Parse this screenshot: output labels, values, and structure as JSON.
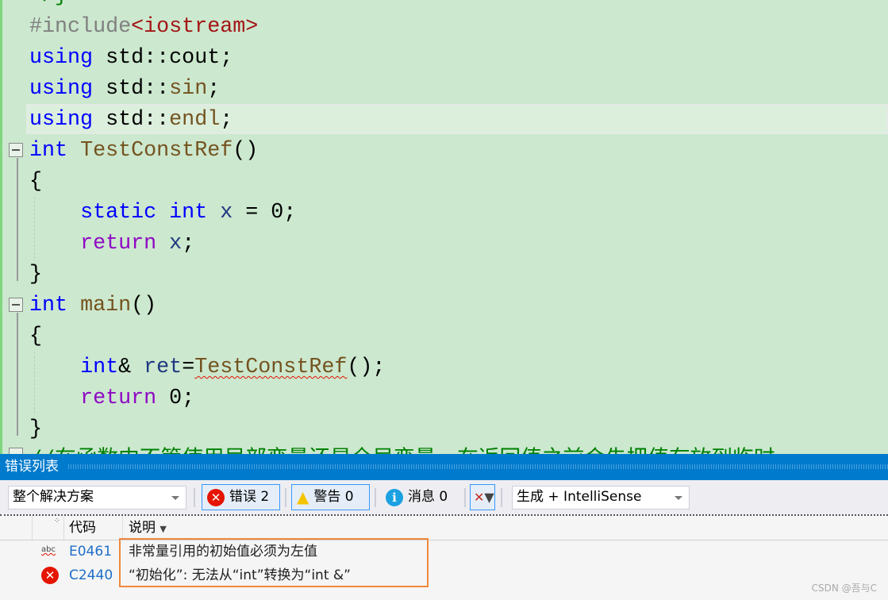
{
  "editor": {
    "lines": [
      [
        [
          "*/}",
          "cm"
        ]
      ],
      [
        [
          "#include",
          "pp"
        ],
        [
          "<iostream>",
          "inc"
        ]
      ],
      [
        [
          "using",
          "kw"
        ],
        [
          " std::cout;",
          ""
        ]
      ],
      [
        [
          "using",
          "kw"
        ],
        [
          " std::",
          ""
        ],
        [
          "sin",
          "fn"
        ],
        [
          ";",
          ""
        ]
      ],
      [
        [
          "using",
          "kw"
        ],
        [
          " std::",
          ""
        ],
        [
          "endl",
          "fn"
        ],
        [
          ";",
          ""
        ]
      ],
      [
        [
          "int",
          "kw"
        ],
        [
          " ",
          ""
        ],
        [
          "TestConstRef",
          "fn"
        ],
        [
          "()",
          ""
        ]
      ],
      [
        [
          "{",
          ""
        ]
      ],
      [
        [
          "    ",
          ""
        ],
        [
          "static",
          "kw"
        ],
        [
          " ",
          ""
        ],
        [
          "int",
          "kw"
        ],
        [
          " ",
          ""
        ],
        [
          "x",
          "var"
        ],
        [
          " = 0;",
          ""
        ]
      ],
      [
        [
          "    ",
          ""
        ],
        [
          "return",
          "ret"
        ],
        [
          " ",
          ""
        ],
        [
          "x",
          "var"
        ],
        [
          ";",
          ""
        ]
      ],
      [
        [
          "}",
          ""
        ]
      ],
      [
        [
          "int",
          "kw"
        ],
        [
          " ",
          ""
        ],
        [
          "main",
          "fn"
        ],
        [
          "()",
          ""
        ]
      ],
      [
        [
          "{",
          ""
        ]
      ],
      [
        [
          "    ",
          ""
        ],
        [
          "int",
          "kw"
        ],
        [
          "& ",
          ""
        ],
        [
          "ret",
          "var"
        ],
        [
          "=",
          ""
        ],
        [
          "TestConstRef",
          "fn squig"
        ],
        [
          "();",
          ""
        ]
      ],
      [
        [
          "    ",
          ""
        ],
        [
          "return",
          "ret"
        ],
        [
          " 0;",
          ""
        ]
      ],
      [
        [
          "}",
          ""
        ]
      ],
      [
        [
          "//在函数中不管使用局部变量还是全局变量，在返回值之前会先把值存放到临时",
          "cm"
        ]
      ]
    ]
  },
  "panel": {
    "title": "错误列表",
    "scope": "整个解决方案",
    "errors": "错误 2",
    "warnings": "警告 0",
    "messages": "消息 0",
    "source": "生成 + IntelliSense",
    "col_code": "代码",
    "col_desc": "说明",
    "rows": [
      {
        "icon": "intellisense-squiggle-icon",
        "code": "E0461",
        "desc": "非常量引用的初始值必须为左值"
      },
      {
        "icon": "error-icon",
        "code": "C2440",
        "desc": "“初始化”: 无法从“int”转换为“int &”"
      }
    ]
  },
  "watermark": "CSDN @吾与C",
  "colors": {
    "accent": "#007acc",
    "error": "#e51400",
    "highlight_box": "#f0883c"
  }
}
